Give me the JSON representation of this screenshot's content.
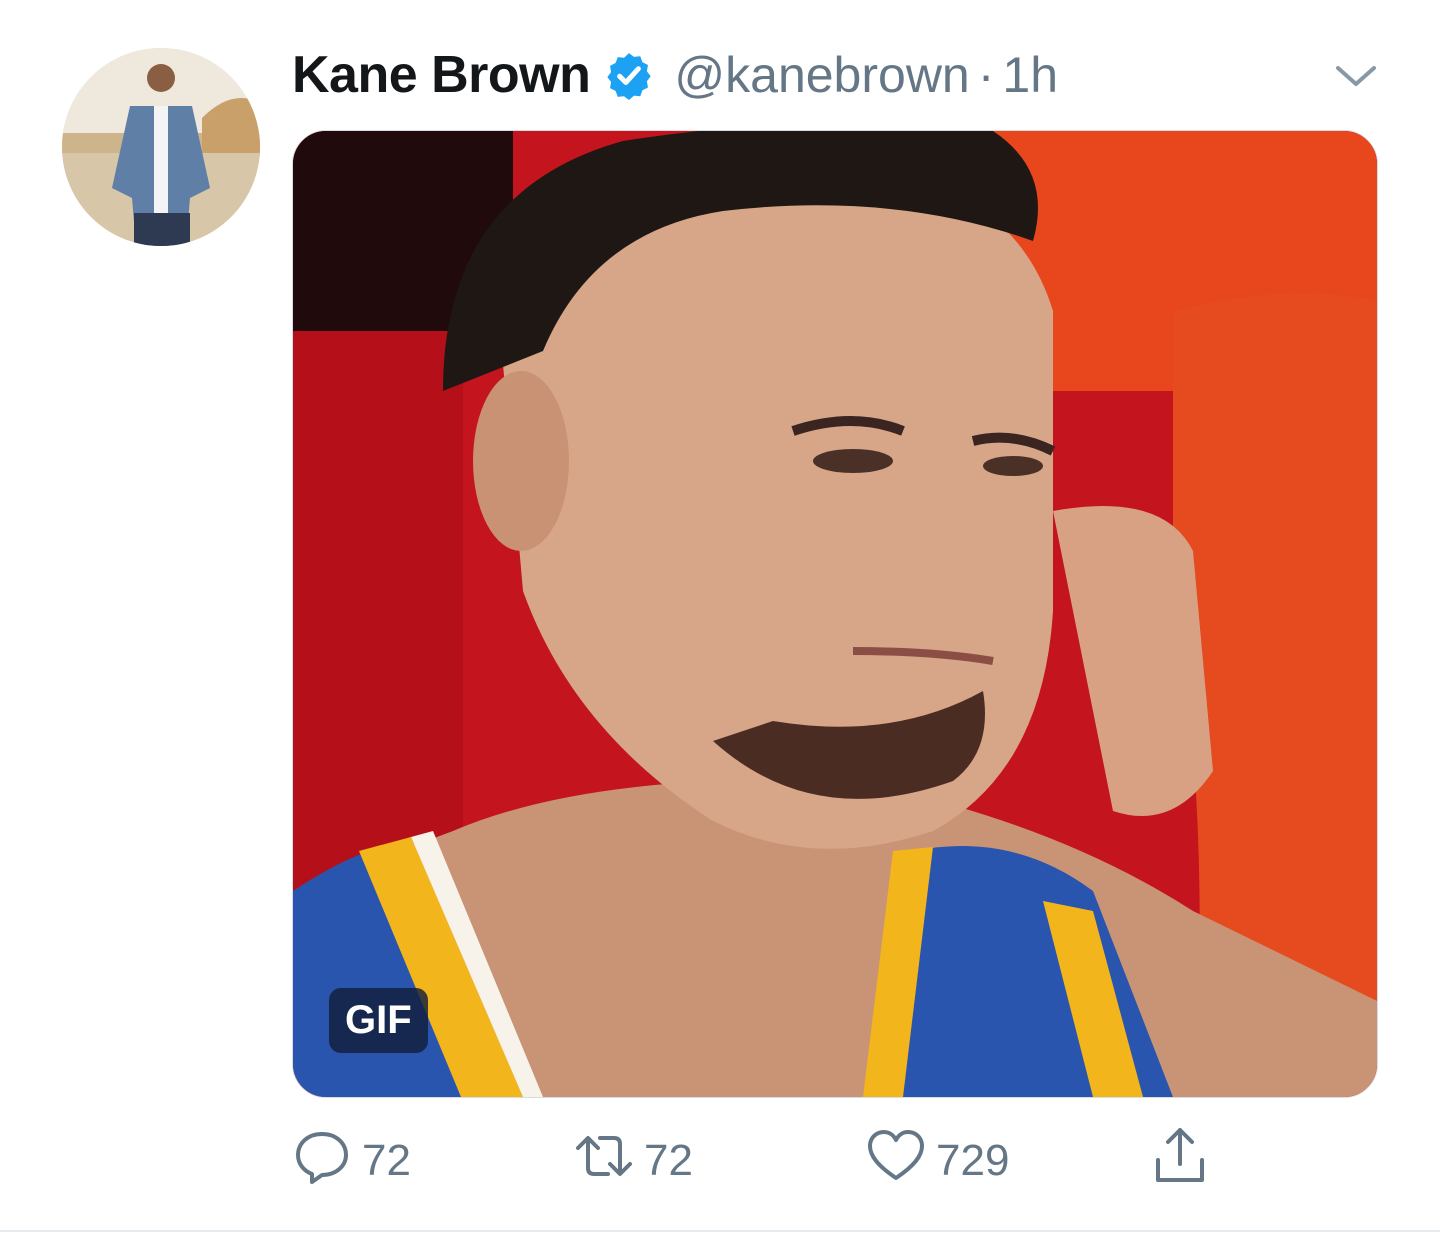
{
  "tweet": {
    "author_name": "Kane Brown",
    "handle": "@kanebrown",
    "separator": "·",
    "timestamp": "1h",
    "media_badge": "GIF",
    "reply_count": "72",
    "retweet_count": "72",
    "like_count": "729"
  },
  "icons": {
    "verified": "verified-badge-icon",
    "menu": "chevron-down-icon",
    "reply": "reply-icon",
    "retweet": "retweet-icon",
    "like": "heart-icon",
    "share": "share-icon"
  },
  "colors": {
    "verified": "#1da1f2",
    "secondary_text": "#657786",
    "primary_text": "#14171a"
  }
}
